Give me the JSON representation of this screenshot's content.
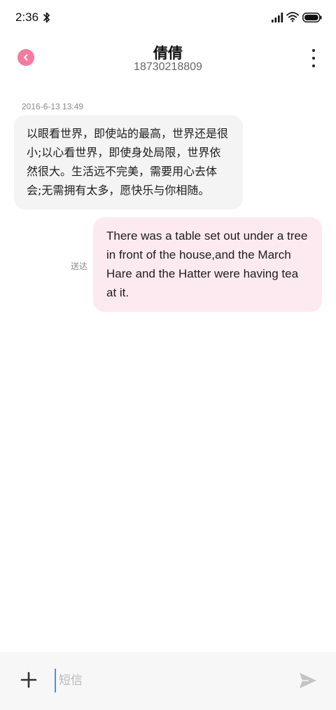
{
  "status_bar": {
    "time": "2:36",
    "icons": [
      "bluetooth-icon",
      "signal-icon",
      "wifi-icon",
      "battery-icon"
    ]
  },
  "header": {
    "contact_name": "倩倩",
    "contact_number": "18730218809",
    "back_icon": "chevron-left-icon",
    "more_icon": "more-vertical-icon",
    "accent_color": "#f57aa1"
  },
  "conversation": {
    "timestamp": "2016-6-13 13:49",
    "messages": [
      {
        "direction": "incoming",
        "text": "以眼看世界，即使站的最高，世界还是很小;以心看世界，即使身处局限，世界依然很大。生活远不完美，需要用心去体会;无需拥有太多，愿快乐与你相随。",
        "bubble_color": "#f4f4f4"
      },
      {
        "direction": "outgoing",
        "status": "送达",
        "text": "There was a table set out under a tree in front of the house,and the March Hare and the Hatter were having tea at it.",
        "bubble_color": "#fdeaf0"
      }
    ]
  },
  "input_bar": {
    "placeholder": "短信",
    "value": "",
    "add_icon": "plus-icon",
    "send_icon": "send-icon"
  }
}
